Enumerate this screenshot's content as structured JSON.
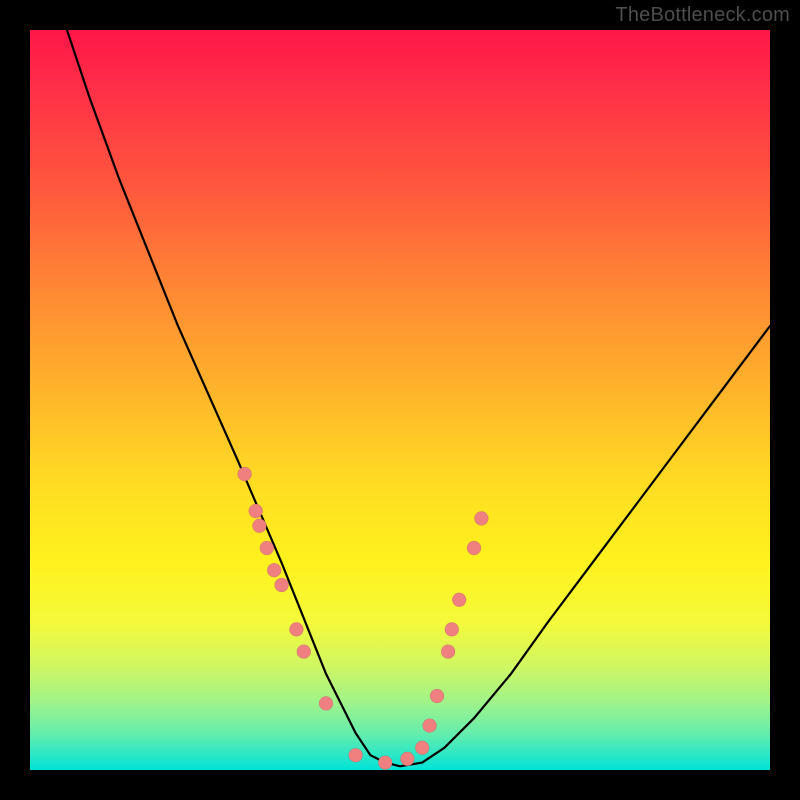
{
  "watermark": "TheBottleneck.com",
  "colors": {
    "background": "#000000",
    "gradient_top": "#ff1648",
    "gradient_mid": "#ffde22",
    "gradient_bottom": "#00e3d8",
    "curve": "#000000",
    "dot": "#f08080"
  },
  "chart_data": {
    "type": "line",
    "title": "",
    "xlabel": "",
    "ylabel": "",
    "xlim": [
      0,
      100
    ],
    "ylim": [
      0,
      100
    ],
    "series": [
      {
        "name": "curve",
        "x": [
          5,
          8,
          12,
          16,
          20,
          24,
          28,
          31,
          34,
          36,
          38,
          40,
          42,
          44,
          46,
          48,
          50,
          53,
          56,
          60,
          65,
          70,
          76,
          82,
          88,
          94,
          100
        ],
        "y": [
          100,
          91,
          80,
          70,
          60,
          51,
          42,
          35,
          28,
          23,
          18,
          13,
          9,
          5,
          2,
          1,
          0.5,
          1,
          3,
          7,
          13,
          20,
          28,
          36,
          44,
          52,
          60
        ]
      }
    ],
    "points": {
      "name": "markers",
      "x": [
        29,
        30.5,
        31,
        32,
        33,
        34,
        36,
        37,
        40,
        44,
        48,
        51,
        53,
        54,
        55,
        56.5,
        57,
        58,
        60,
        61
      ],
      "y": [
        40,
        35,
        33,
        30,
        27,
        25,
        19,
        16,
        9,
        2,
        1,
        1.5,
        3,
        6,
        10,
        16,
        19,
        23,
        30,
        34
      ]
    }
  }
}
